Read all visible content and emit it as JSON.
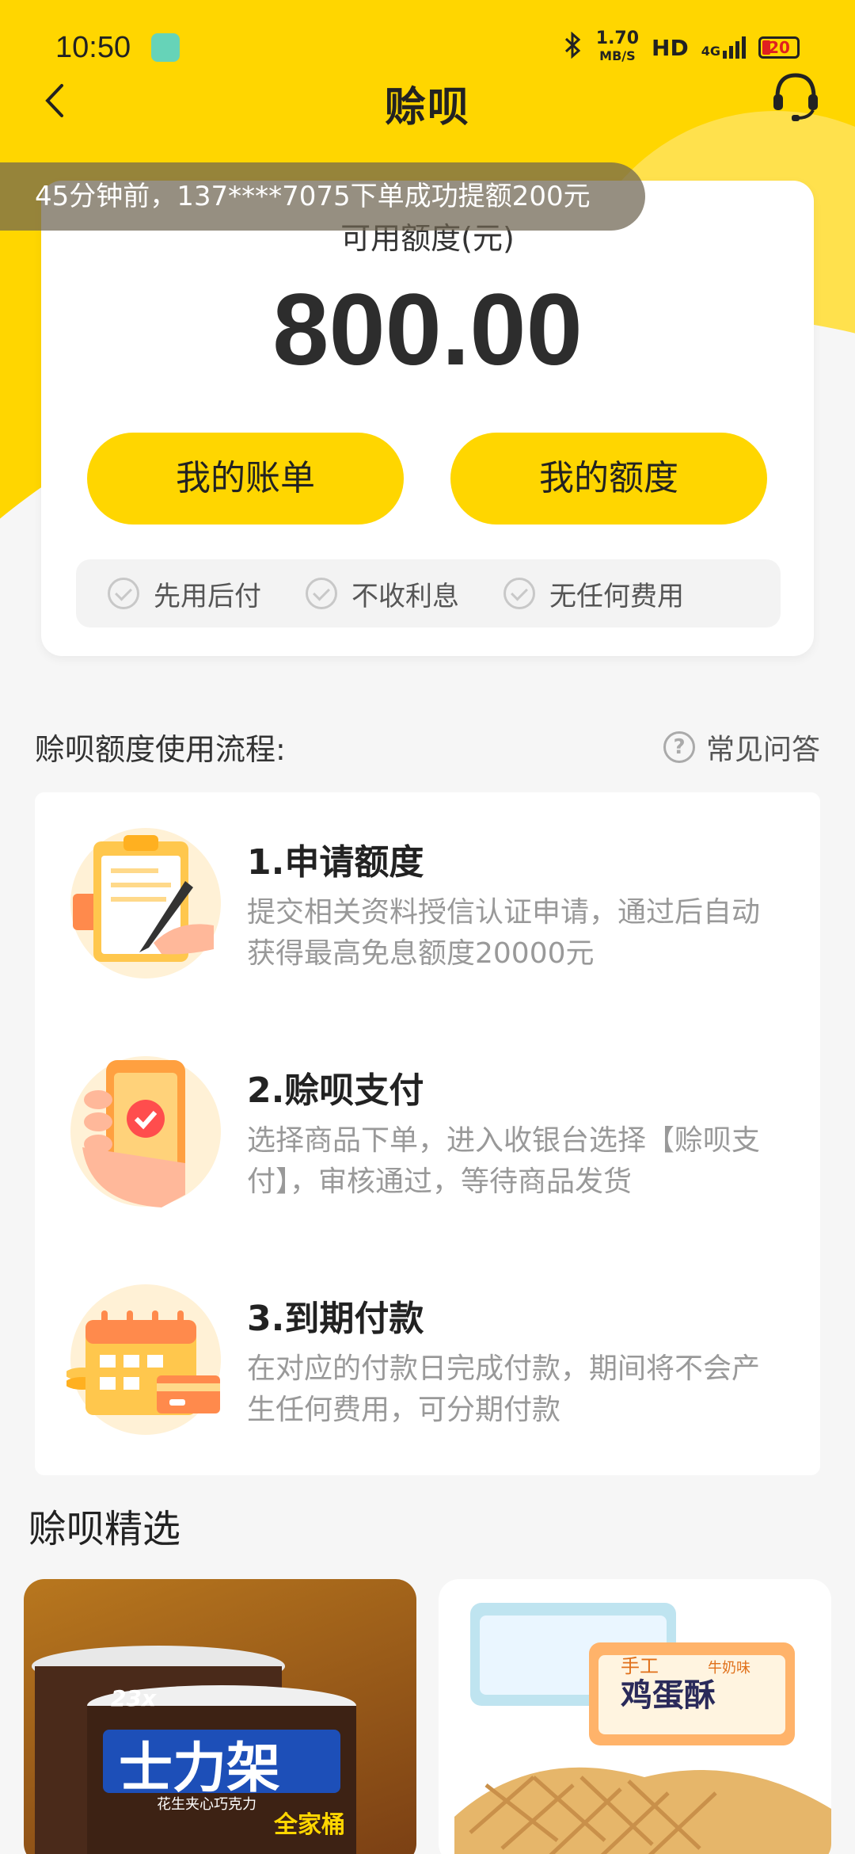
{
  "status_bar": {
    "time": "10:50",
    "speed_value": "1.70",
    "speed_unit": "MB/S",
    "hd": "HD",
    "network": "4G",
    "battery": "20"
  },
  "nav": {
    "title": "赊呗"
  },
  "toast": {
    "text": "45分钟前，137****7075下单成功提额200元"
  },
  "credit": {
    "label": "可用额度(元)",
    "amount": "800.00",
    "bill_button": "我的账单",
    "limit_button": "我的额度",
    "features": [
      "先用后付",
      "不收利息",
      "无任何费用"
    ]
  },
  "process": {
    "title": "赊呗额度使用流程:",
    "faq_label": "常见问答",
    "steps": [
      {
        "title": "1.申请额度",
        "desc": "提交相关资料授信认证申请，通过后自动获得最高免息额度20000元"
      },
      {
        "title": "2.赊呗支付",
        "desc": "选择商品下单，进入收银台选择【赊呗支付】，审核通过，等待商品发货"
      },
      {
        "title": "3.到期付款",
        "desc": "在对应的付款日完成付款，期间将不会产生任何费用，可分期付款"
      }
    ]
  },
  "picks": {
    "title": "赊呗精选",
    "products": [
      {
        "brand": "士力架",
        "tag": "全家桶",
        "count": "23x",
        "subtitle": "花生夹心巧克力"
      },
      {
        "brand": "鸡蛋酥",
        "tag": "手工",
        "subtitle": "牛奶味"
      }
    ]
  },
  "colors": {
    "accent": "#ffd600",
    "background": "#f6f6f6"
  }
}
